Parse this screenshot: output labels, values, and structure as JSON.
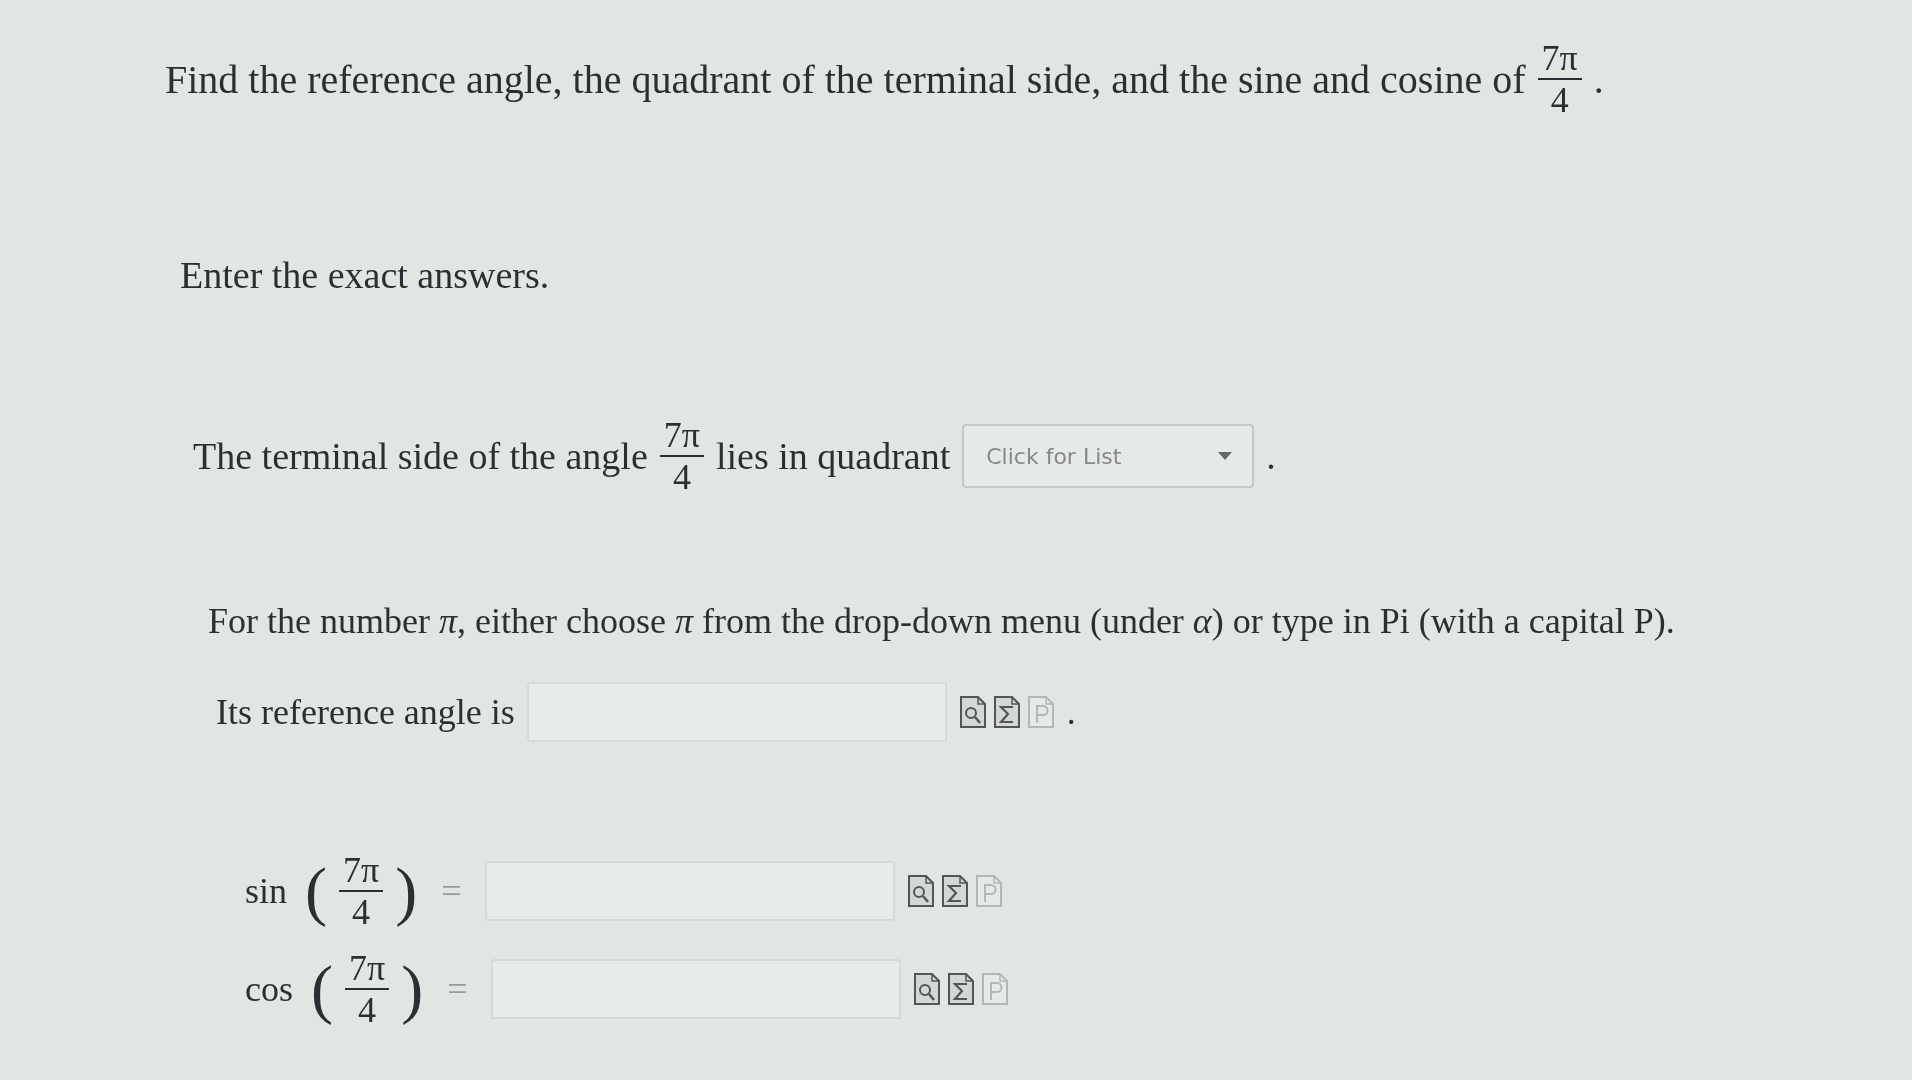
{
  "question": {
    "text": "Find the reference angle, the quadrant of the terminal side, and the sine and cosine of",
    "fraction": {
      "num": "7π",
      "den": "4"
    },
    "end": "."
  },
  "instruction": "Enter the exact answers.",
  "quadrant": {
    "before": "The terminal side of the angle",
    "fraction": {
      "num": "7π",
      "den": "4"
    },
    "after": "lies in quadrant",
    "dropdown": {
      "placeholder": "Click for List"
    },
    "end": "."
  },
  "note": "For the number *π*, either choose *π* from the drop-down menu (under *α*) or type in Pi (with a capital P).",
  "reference": {
    "label": "Its reference angle is",
    "end": ".",
    "tools": [
      {
        "kind": "preview",
        "disabled": false
      },
      {
        "kind": "sigma",
        "disabled": false
      },
      {
        "kind": "pi",
        "disabled": true
      }
    ]
  },
  "functions": [
    {
      "name": "sin",
      "open": "(",
      "num": "7π",
      "den": "4",
      "close": ")",
      "equals": "=",
      "tools": [
        {
          "kind": "preview",
          "disabled": false
        },
        {
          "kind": "sigma",
          "disabled": false
        },
        {
          "kind": "pi",
          "disabled": true
        }
      ]
    },
    {
      "name": "cos",
      "open": "(",
      "num": "7π",
      "den": "4",
      "close": ")",
      "equals": "=",
      "tools": [
        {
          "kind": "preview",
          "disabled": false
        },
        {
          "kind": "sigma",
          "disabled": false
        },
        {
          "kind": "pi",
          "disabled": true
        }
      ]
    }
  ]
}
